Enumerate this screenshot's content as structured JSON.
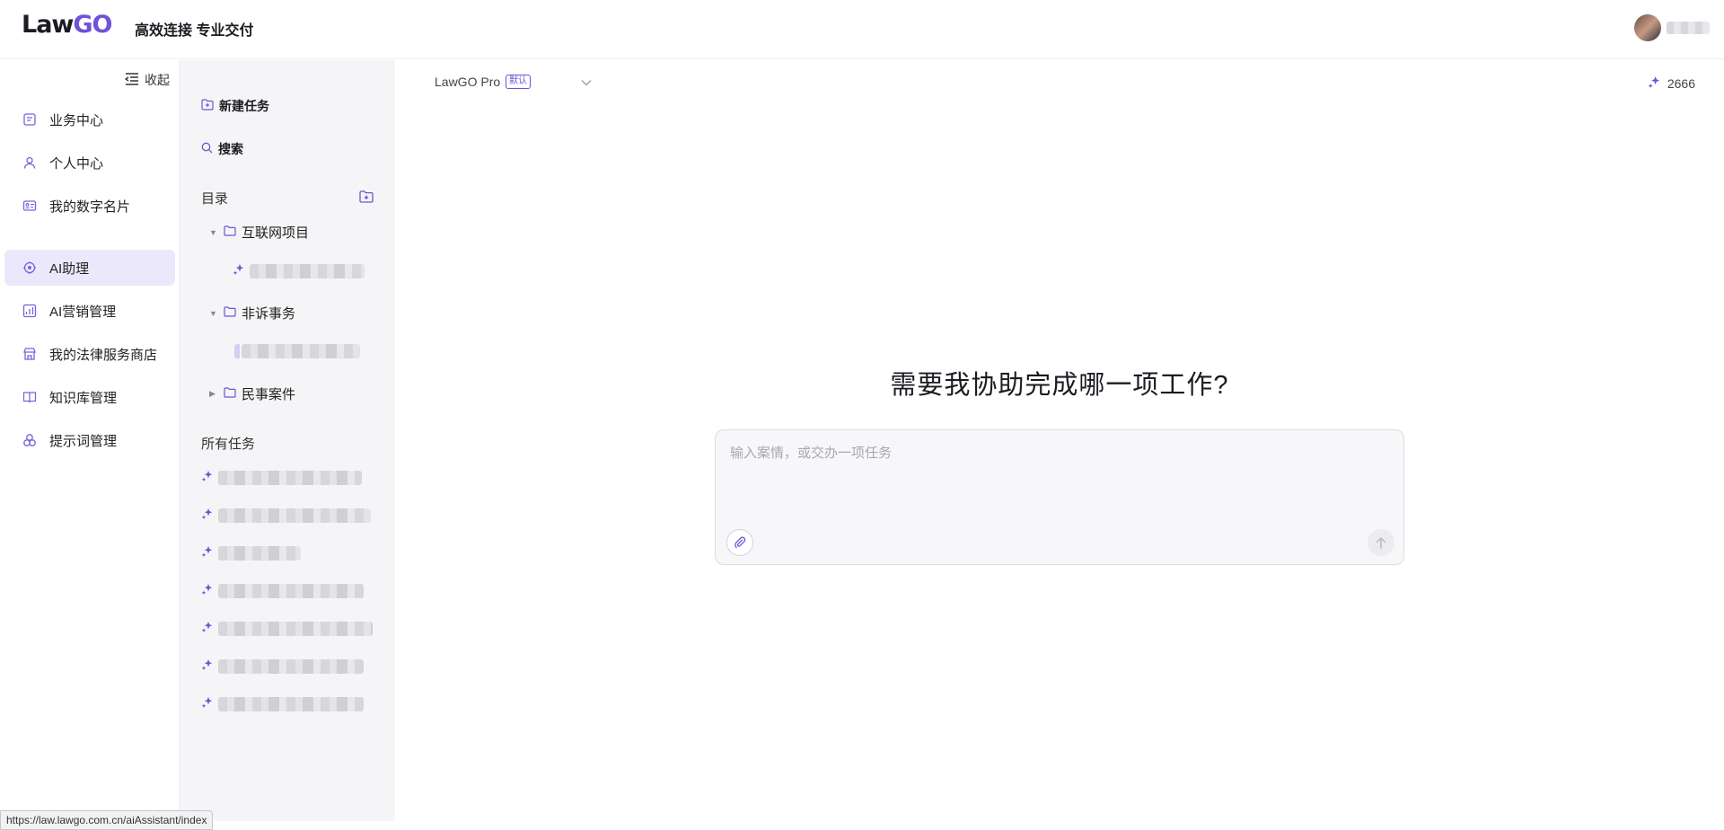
{
  "header": {
    "logo_law": "Law",
    "logo_go": "GO",
    "slogan": "高效连接 专业交付"
  },
  "nav": {
    "collapse_label": "收起",
    "items": [
      {
        "label": "业务中心",
        "icon": "business-icon"
      },
      {
        "label": "个人中心",
        "icon": "user-icon"
      },
      {
        "label": "我的数字名片",
        "icon": "card-icon"
      },
      {
        "label": "AI助理",
        "icon": "ai-assistant-icon"
      },
      {
        "label": "AI营销管理",
        "icon": "chart-icon"
      },
      {
        "label": "我的法律服务商店",
        "icon": "store-icon"
      },
      {
        "label": "知识库管理",
        "icon": "book-icon"
      },
      {
        "label": "提示词管理",
        "icon": "prompt-icon"
      }
    ]
  },
  "panel": {
    "new_task": "新建任务",
    "search": "搜索",
    "directory_label": "目录",
    "folders": [
      {
        "name": "互联网项目",
        "expanded": true
      },
      {
        "name": "非诉事务",
        "expanded": true
      },
      {
        "name": "民事案件",
        "expanded": false
      }
    ],
    "all_tasks_label": "所有任务"
  },
  "main": {
    "model_name": "LawGO Pro",
    "model_badge": "默认",
    "credits": "2666",
    "title": "需要我协助完成哪一项工作?",
    "input_placeholder": "输入案情，或交办一项任务"
  },
  "status_url": "https://law.lawgo.com.cn/aiAssistant/index",
  "colors": {
    "accent": "#6f53d6",
    "active_bg": "#ece8fb",
    "panel_bg": "#f5f5f7"
  }
}
